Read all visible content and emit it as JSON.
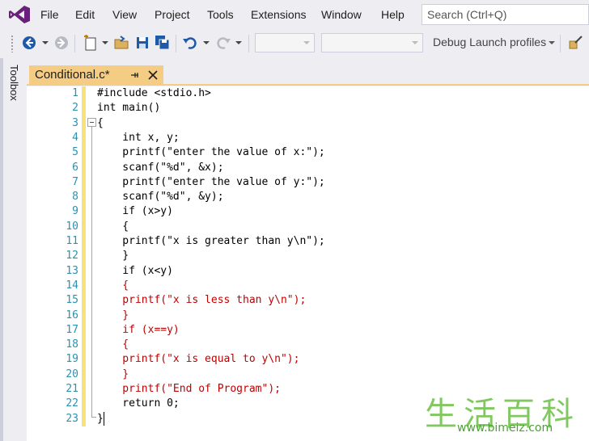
{
  "menu": {
    "items": [
      "File",
      "Edit",
      "View",
      "Project",
      "Tools",
      "Extensions",
      "Window",
      "Help"
    ],
    "search_placeholder": "Search (Ctrl+Q)"
  },
  "toolbar": {
    "debug_profiles_label": "Debug Launch profiles"
  },
  "toolbox": {
    "label": "Toolbox"
  },
  "tab": {
    "title": "Conditional.c*"
  },
  "editor": {
    "lines": [
      {
        "n": "1",
        "text": "#include <stdio.h>",
        "color": "black"
      },
      {
        "n": "2",
        "text": "int main()",
        "color": "black"
      },
      {
        "n": "3",
        "text": "{",
        "color": "black"
      },
      {
        "n": "4",
        "text": "    int x, y;",
        "color": "black"
      },
      {
        "n": "5",
        "text": "    printf(\"enter the value of x:\");",
        "color": "black"
      },
      {
        "n": "6",
        "text": "    scanf(\"%d\", &x);",
        "color": "black"
      },
      {
        "n": "7",
        "text": "    printf(\"enter the value of y:\");",
        "color": "black"
      },
      {
        "n": "8",
        "text": "    scanf(\"%d\", &y);",
        "color": "black"
      },
      {
        "n": "9",
        "text": "    if (x>y)",
        "color": "black"
      },
      {
        "n": "10",
        "text": "    {",
        "color": "black"
      },
      {
        "n": "11",
        "text": "    printf(\"x is greater than y\\n\");",
        "color": "black"
      },
      {
        "n": "12",
        "text": "    }",
        "color": "black"
      },
      {
        "n": "13",
        "text": "    if (x<y)",
        "color": "black"
      },
      {
        "n": "14",
        "text": "    {",
        "color": "red"
      },
      {
        "n": "15",
        "text": "    printf(\"x is less than y\\n\");",
        "color": "red"
      },
      {
        "n": "16",
        "text": "    }",
        "color": "red"
      },
      {
        "n": "17",
        "text": "    if (x==y)",
        "color": "red"
      },
      {
        "n": "18",
        "text": "    {",
        "color": "red"
      },
      {
        "n": "19",
        "text": "    printf(\"x is equal to y\\n\");",
        "color": "red"
      },
      {
        "n": "20",
        "text": "    }",
        "color": "red"
      },
      {
        "n": "21",
        "text": "    printf(\"End of Program\");",
        "color": "red"
      },
      {
        "n": "22",
        "text": "    return 0;",
        "color": "black"
      },
      {
        "n": "23",
        "text": "}",
        "color": "black"
      }
    ]
  },
  "watermark": {
    "chars": "生活百科",
    "url": "www.bimeiz.com"
  },
  "colors": {
    "accent_purple": "#68217a",
    "tab_active": "#f5cc84",
    "line_number": "#2b91af",
    "margin_modified": "#f7e27a"
  }
}
